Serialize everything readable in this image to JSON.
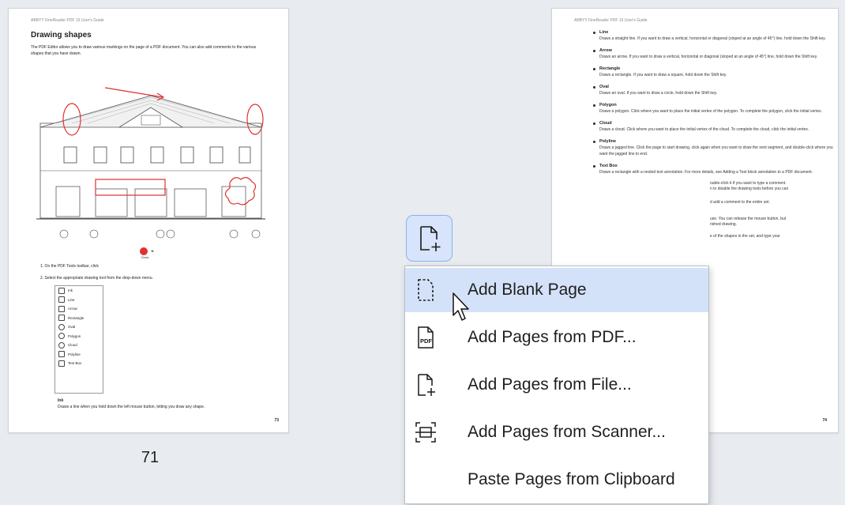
{
  "left_page": {
    "header": "ABBYY FineReader PDF 15 User's Guide",
    "heading": "Drawing shapes",
    "intro": "The PDF Editor allows you to draw various markings on the page of a PDF document. You can also add comments to the various shapes that you have drawn.",
    "step1": "1.  On the PDF Tools toolbar, click",
    "step2": "2.  Select the appropriate drawing tool from the drop-down menu.",
    "tools": [
      "Ink",
      "Line",
      "Arrow",
      "Rectangle",
      "Oval",
      "Polygon",
      "Cloud",
      "Polyline",
      "Text Box"
    ],
    "ink_title": "Ink",
    "ink_desc": "Draws a line when you hold down the left mouse button, letting you draw any shape.",
    "footer_num": "73",
    "page_number_label": "71"
  },
  "right_page": {
    "header": "ABBYY FineReader PDF 15 User's Guide",
    "items": [
      {
        "title": "Line",
        "desc": "Draws a straight line. If you want to draw a vertical, horizontal or diagonal (sloped at an angle of 45°) line, hold down the Shift key."
      },
      {
        "title": "Arrow",
        "desc": "Draws an arrow. If you want to draw a vertical, horizontal or diagonal (sloped at an angle of 45°) line, hold down the Shift key."
      },
      {
        "title": "Rectangle",
        "desc": "Draws a rectangle. If you want to draw a square, hold down the Shift key."
      },
      {
        "title": "Oval",
        "desc": "Draws an oval. If you want to draw a circle, hold down the Shift key."
      },
      {
        "title": "Polygon",
        "desc": "Draws a polygon. Click where you want to place the initial vertex of the polygon. To complete the polygon, click the initial vertex."
      },
      {
        "title": "Cloud",
        "desc": "Draws a cloud. Click where you want to place the initial vertex of the cloud. To complete the cloud, click the initial vertex."
      },
      {
        "title": "Polyline",
        "desc": "Draws a jagged line. Click the page to start drawing, click again when you want to draw the next segment, and double-click where you want the jagged line to end."
      },
      {
        "title": "Text Box",
        "desc": "Draws a rectangle with a nested text annotation. For more details, see Adding a Text block annotation to a PDF document."
      }
    ],
    "partial_lines": [
      "ouble-click it if you want to type a comment.",
      "n to disable the drawing tools before you can",
      "d add a comment to the entire set.",
      "use. You can release the mouse button, but",
      "rished drawing.",
      "e of the shapes in the set, and type your"
    ],
    "footer_num": "74"
  },
  "menu": {
    "items": [
      {
        "label": "Add Blank Page",
        "icon": "blank-page-icon"
      },
      {
        "label": "Add Pages from PDF...",
        "icon": "pdf-file-icon"
      },
      {
        "label": "Add Pages from File...",
        "icon": "file-add-icon"
      },
      {
        "label": "Add Pages from Scanner...",
        "icon": "scanner-icon"
      },
      {
        "label": "Paste Pages from Clipboard",
        "icon": ""
      }
    ],
    "hovered_index": 0
  },
  "colors": {
    "accent": "#d7e4fb",
    "hover": "#d4e2f9",
    "markup_red": "#e03030"
  }
}
